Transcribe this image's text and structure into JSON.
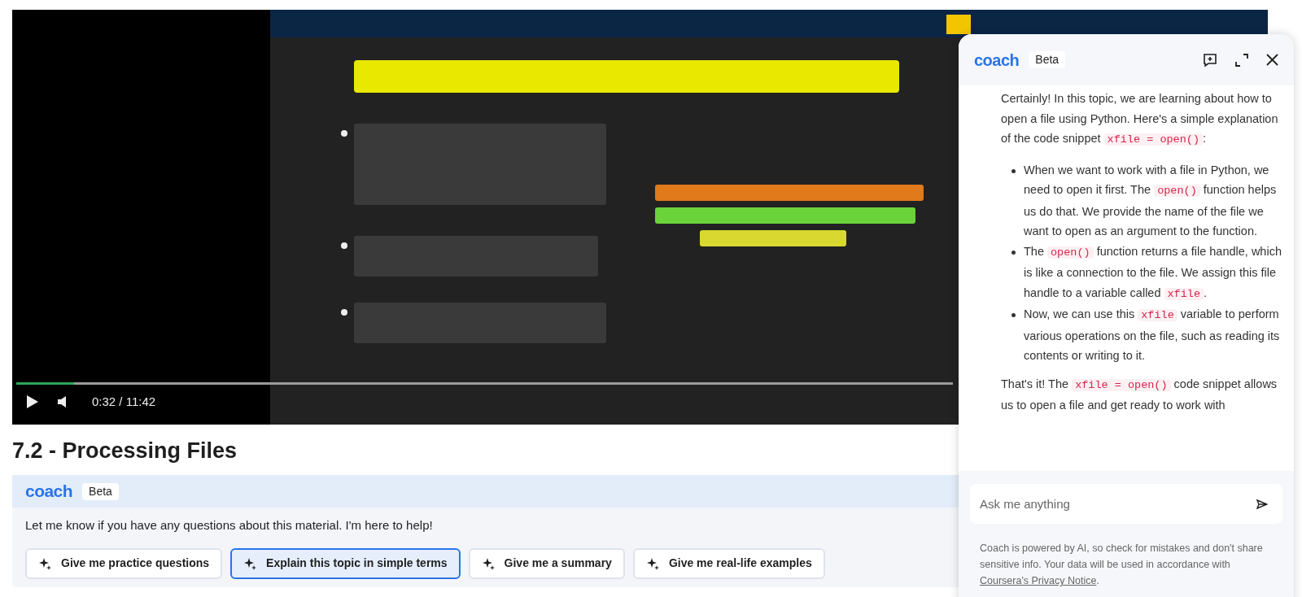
{
  "video": {
    "progress": {
      "level": 0.062
    },
    "time": "0:32 / 11:42"
  },
  "lesson_title": "7.2 - Processing Files",
  "coach_card": {
    "logo": "coach",
    "badge": "Beta",
    "message": "Let me know if you have any questions about this material. I'm here to help!",
    "suggestions": [
      {
        "label": "Give me practice questions",
        "selected": false
      },
      {
        "label": "Explain this topic in simple terms",
        "selected": true
      },
      {
        "label": "Give me a summary",
        "selected": false
      },
      {
        "label": "Give me real-life examples",
        "selected": false
      }
    ]
  },
  "coach_panel": {
    "logo": "coach",
    "badge": "Beta",
    "messages": [
      {
        "kind": "paragraph",
        "parts": [
          {
            "kind": "text",
            "text": "Certainly! In this topic, we are learning about how to open a file using Python. Here's a simple explanation of the code snippet "
          },
          {
            "kind": "code",
            "text": "xfile = open()"
          },
          {
            "kind": "text",
            "text": ":"
          }
        ]
      },
      {
        "kind": "bullets",
        "items": [
          [
            {
              "kind": "text",
              "text": "When we want to work with a file in Python, we need to open it first. The "
            },
            {
              "kind": "code",
              "text": "open()"
            },
            {
              "kind": "text",
              "text": " function helps us do that. We provide the name of the file we want to open as an argument to the function."
            }
          ],
          [
            {
              "kind": "text",
              "text": "The "
            },
            {
              "kind": "code",
              "text": "open()"
            },
            {
              "kind": "text",
              "text": " function returns a file handle, which is like a connection to the file. We assign this file handle to a variable called "
            },
            {
              "kind": "code",
              "text": "xfile"
            },
            {
              "kind": "text",
              "text": "."
            }
          ],
          [
            {
              "kind": "text",
              "text": "Now, we can use this "
            },
            {
              "kind": "code",
              "text": "xfile"
            },
            {
              "kind": "text",
              "text": " variable to perform various operations on the file, such as reading its contents or writing to it."
            }
          ]
        ]
      },
      {
        "kind": "paragraph",
        "parts": [
          {
            "kind": "text",
            "text": "That's it! The "
          },
          {
            "kind": "code",
            "text": "xfile = open()"
          },
          {
            "kind": "text",
            "text": " code snippet allows us to open a file and get ready to work with"
          }
        ]
      }
    ],
    "input": {
      "placeholder": "Ask me anything"
    },
    "disclaimer": "Coach is powered by AI, so check for mistakes and don't share sensitive info. Your data will be used in accordance with ",
    "disclaimer_link": "Coursera's Privacy Notice",
    "disclaimer_end": "."
  }
}
